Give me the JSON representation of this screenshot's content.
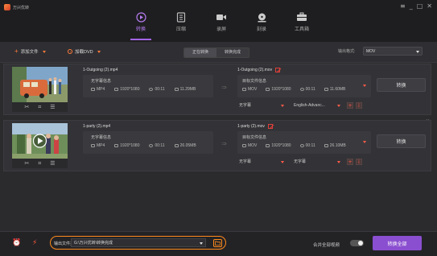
{
  "app": {
    "title": "万兴优转"
  },
  "window_controls": [
    "≡",
    "_",
    "□",
    "✕"
  ],
  "tabs": [
    {
      "label": "转换",
      "icon": "convert-icon",
      "active": true
    },
    {
      "label": "压缩",
      "icon": "compress-icon",
      "active": false
    },
    {
      "label": "录屏",
      "icon": "record-icon",
      "active": false
    },
    {
      "label": "刻录",
      "icon": "burn-icon",
      "active": false
    },
    {
      "label": "工具箱",
      "icon": "toolbox-icon",
      "active": false
    }
  ],
  "toolbar": {
    "add_file": "添加文件",
    "load_dvd": "加载DVD",
    "segments": [
      "正在转换",
      "转换完成"
    ],
    "output_format_label": "输出格式:",
    "output_format_value": "MOV"
  },
  "files": [
    {
      "source_name": "1-Outgoing (2).mp4",
      "source_subtitle": "无字幕信息",
      "source_meta": {
        "format": "MP4",
        "resolution": "1920*1080",
        "duration": "00:11",
        "size": "11.29MB"
      },
      "target_name": "1-Outgoing (2).mov",
      "target_subtitle": "目标文件信息",
      "target_meta": {
        "format": "MOV",
        "resolution": "1920*1080",
        "duration": "00:11",
        "size": "11.60MB"
      },
      "subtitle_select": "无字幕",
      "audio_select": "English-Advanc...",
      "convert_label": "转换"
    },
    {
      "source_name": "1-party (2).mp4",
      "source_subtitle": "无字幕信息",
      "source_meta": {
        "format": "MP4",
        "resolution": "1920*1080",
        "duration": "00:11",
        "size": "26.05MB"
      },
      "target_name": "1-party (2).mov",
      "target_subtitle": "目标文件信息",
      "target_meta": {
        "format": "MOV",
        "resolution": "1920*1080",
        "duration": "00:11",
        "size": "26.10MB"
      },
      "subtitle_select": "无字幕",
      "audio_select": "无字幕",
      "convert_label": "转换"
    }
  ],
  "bottom": {
    "output_folder_label": "输出文件夹",
    "output_folder_path": "G:\\万兴优转\\转换完成",
    "merge_label": "合并全部视频",
    "convert_all": "转换全部"
  },
  "colors": {
    "accent_purple": "#8a4fd0",
    "accent_orange": "#ff8a1a",
    "accent_red": "#e0403a"
  }
}
